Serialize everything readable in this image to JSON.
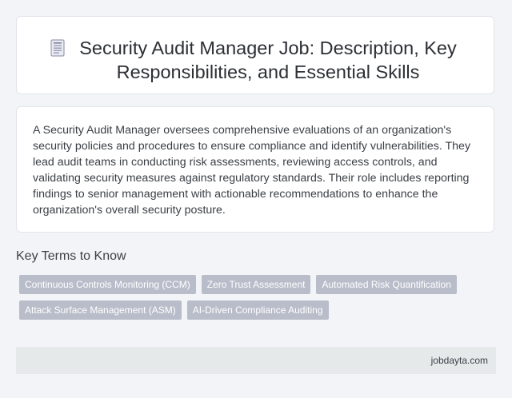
{
  "header": {
    "icon": "document-icon",
    "title": "Security Audit Manager Job: Description, Key Responsibilities, and Essential Skills"
  },
  "description": "A Security Audit Manager oversees comprehensive evaluations of an organization's security policies and procedures to ensure compliance and identify vulnerabilities. They lead audit teams in conducting risk assessments, reviewing access controls, and validating security measures against regulatory standards. Their role includes reporting findings to senior management with actionable recommendations to enhance the organization's overall security posture.",
  "key_terms": {
    "heading": "Key Terms to Know",
    "rows": [
      [
        "Continuous Controls Monitoring (CCM)",
        "Zero Trust Assessment",
        "Automated Risk Quantification"
      ],
      [
        "Attack Surface Management (ASM)",
        "AI-Driven Compliance Auditing"
      ]
    ]
  },
  "footer": {
    "site": "jobdayta.com"
  },
  "colors": {
    "page_bg": "#f3f4f7",
    "card_bg": "#ffffff",
    "tag_bg": "#b9bdca",
    "footer_bg": "#e5e9ea"
  }
}
